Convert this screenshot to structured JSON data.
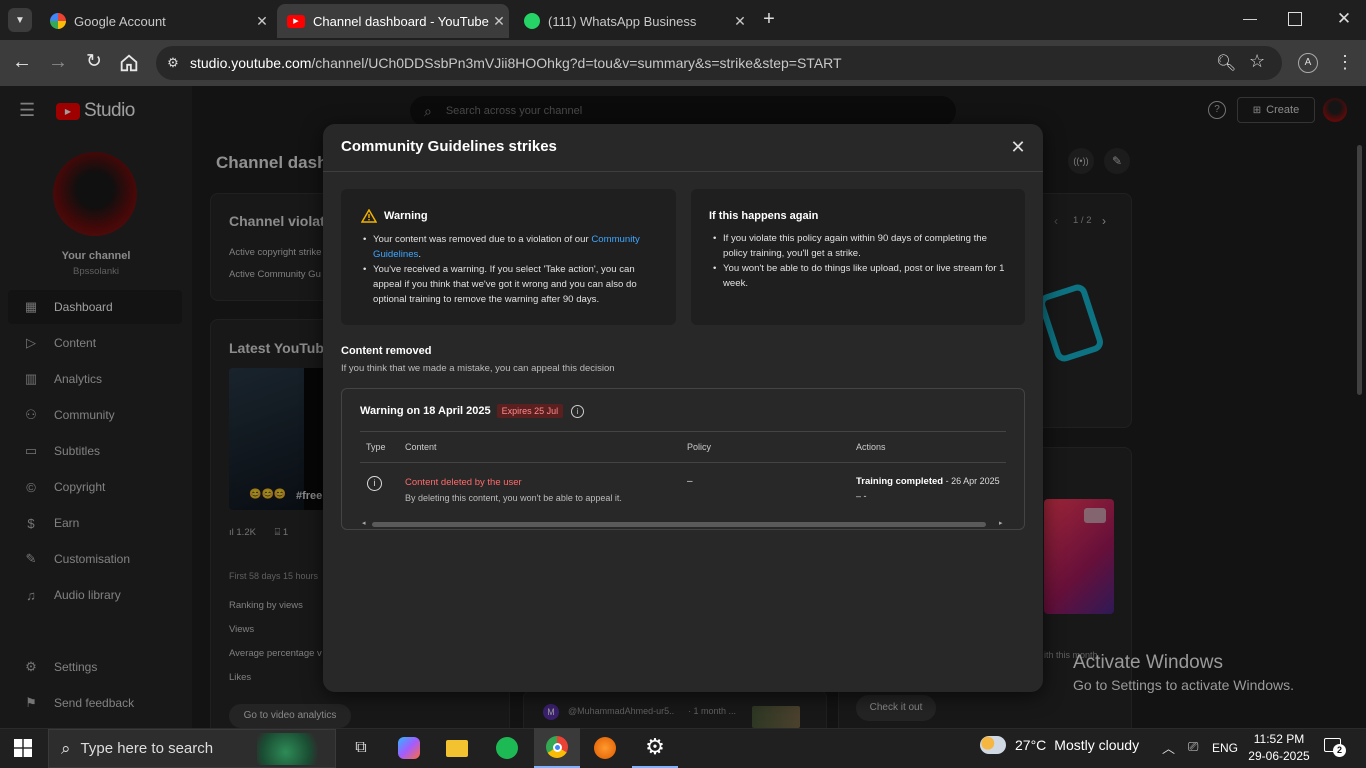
{
  "browser": {
    "tabs": [
      {
        "title": "Google Account",
        "icon": "google-g-icon"
      },
      {
        "title": "Channel dashboard - YouTube S",
        "icon": "youtube-icon"
      },
      {
        "title": "(111) WhatsApp Business",
        "icon": "whatsapp-icon"
      }
    ],
    "new_tab": "+",
    "url_host": "studio.youtube.com",
    "url_path": "/channel/UCh0DDSsbPn3mVJii8HOOhkg?d=tou&v=summary&s=strike&step=START",
    "profile_initial": "A"
  },
  "studio": {
    "logo_text": "Studio",
    "search_placeholder": "Search across your channel",
    "create_label": "Create",
    "channel_label": "Your channel",
    "channel_name": "Bpssolanki",
    "nav": [
      {
        "label": "Dashboard",
        "icon": "dashboard-icon"
      },
      {
        "label": "Content",
        "icon": "content-icon"
      },
      {
        "label": "Analytics",
        "icon": "analytics-icon"
      },
      {
        "label": "Community",
        "icon": "community-icon"
      },
      {
        "label": "Subtitles",
        "icon": "subtitles-icon"
      },
      {
        "label": "Copyright",
        "icon": "copyright-icon"
      },
      {
        "label": "Earn",
        "icon": "dollar-icon"
      },
      {
        "label": "Customisation",
        "icon": "magic-wand-icon"
      },
      {
        "label": "Audio library",
        "icon": "audio-library-icon"
      }
    ],
    "settings_label": "Settings",
    "feedback_label": "Send feedback",
    "page_title": "Channel dash",
    "violations_title": "Channel violati",
    "active_copyright": "Active copyright strike",
    "active_community": "Active Community Gu",
    "latest_title": "Latest YouTube",
    "video_overlay_text": "#free",
    "video_emoji": "😊😊😊",
    "views_count": "1.2K",
    "comments_count": "1",
    "first_days": "First 58 days 15 hours",
    "ranking_label": "Ranking by views",
    "views_label": "Views",
    "avg_pct_label": "Average percentage v",
    "likes_label": "Likes",
    "analytics_button": "Go to video analytics",
    "pager": "1 / 2",
    "comment_author": "@MuhammadAhmed-ur5..",
    "comment_time": "· 1 month ...",
    "check_button": "Check it out",
    "promo_caption": "ith this month"
  },
  "modal": {
    "title": "Community Guidelines strikes",
    "warning_title": "Warning",
    "warning_b1_pre": "Your content was removed due to a violation of our ",
    "warning_b1_link": "Community Guidelines",
    "warning_b1_post": ".",
    "warning_b2": "You've received a warning. If you select 'Take action', you can appeal if you think that we've got it wrong and you can also do optional training to remove the warning after 90 days.",
    "again_title": "If this happens again",
    "again_b1": "If you violate this policy again within 90 days of completing the policy training, you'll get a strike.",
    "again_b2": "You won't be able to do things like upload, post or live stream for 1 week.",
    "removed_title": "Content removed",
    "removed_sub": "If you think that we made a mistake, you can appeal this decision",
    "strike_title": "Warning on 18 April 2025",
    "expires_badge": "Expires 25 Jul",
    "columns": {
      "type": "Type",
      "content": "Content",
      "policy": "Policy",
      "actions": "Actions"
    },
    "row": {
      "content_title": "Content deleted by the user",
      "content_note": "By deleting this content, you won't be able to appeal it.",
      "policy": "–",
      "action_bold": "Training completed",
      "action_date": " - 26 Apr 2025",
      "action_line2": "– -"
    }
  },
  "windows": {
    "search_placeholder": "Type here to search",
    "weather_temp": "27°C",
    "weather_text": "Mostly cloudy",
    "lang": "ENG",
    "time": "11:52 PM",
    "date": "29-06-2025",
    "notif_count": "2",
    "watermark_title": "Activate Windows",
    "watermark_sub": "Go to Settings to activate Windows."
  },
  "colors": {
    "accent_red": "#ff0000",
    "link_blue": "#3ea6ff",
    "badge_bg": "#5a1f1f",
    "badge_text": "#ff8c8c",
    "warning_yellow": "#f2b200",
    "content_red": "#ff6b6b"
  }
}
